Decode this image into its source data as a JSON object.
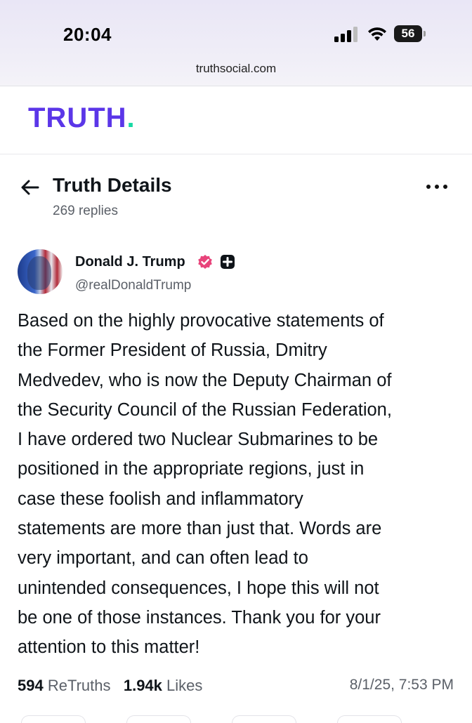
{
  "status_bar": {
    "time": "20:04",
    "battery": "56"
  },
  "browser": {
    "url": "truthsocial.com"
  },
  "brand": {
    "logo_text": "TRUTH",
    "logo_dot": ".",
    "colors": {
      "logo": "#5b36e8",
      "dot": "#17d9a4"
    }
  },
  "header": {
    "title": "Truth Details",
    "replies": "269 replies"
  },
  "post": {
    "author_name": "Donald J. Trump",
    "handle": "@realDonaldTrump",
    "text": "Based on the highly provocative statements of\nthe Former President of Russia, Dmitry\nMedvedev, who is now the Deputy Chairman of\nthe Security Council of the Russian Federation,\nI have ordered two Nuclear Submarines to be\npositioned in the appropriate regions, just in\ncase these foolish and inflammatory\nstatements are more than just that. Words are\nvery important, and can often lead to\nunintended consequences, I hope this will not\nbe one of those instances. Thank you for your\nattention to this matter!",
    "retruths_count": "594",
    "retruths_label": "ReTruths",
    "likes_count": "1.94k",
    "likes_label": "Likes",
    "timestamp": "8/1/25, 7:53 PM"
  },
  "icons": {
    "back": "arrow-left-icon",
    "more": "more-horizontal-icon",
    "verified": "verified-badge-icon",
    "plus": "plus-badge-icon"
  }
}
